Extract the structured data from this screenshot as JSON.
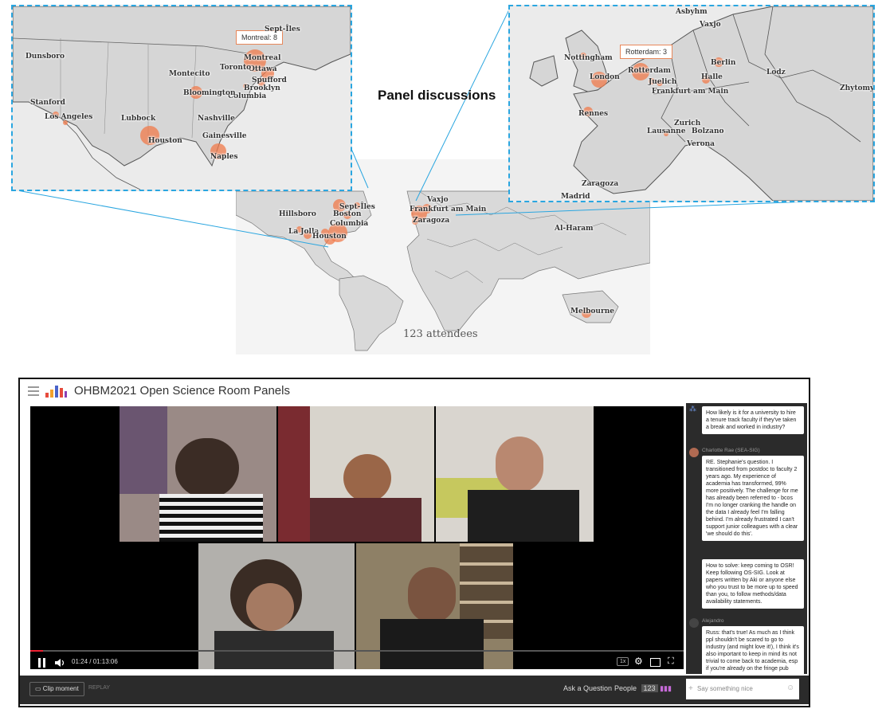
{
  "map": {
    "panel_title": "Panel discussions",
    "attendees_label": "123 attendees",
    "us_tooltip": "Montreal: 8",
    "eu_tooltip": "Rotterdam: 3",
    "us_cities": [
      "Dunsboro",
      "Montreal",
      "Ottawa",
      "Spufford",
      "Brooklyn",
      "Columbia",
      "Bloomington",
      "Stanford",
      "Los Angeles",
      "Lubbock",
      "Nashville",
      "Houston",
      "Gainesville",
      "Naples",
      "Montecito",
      "Toronto",
      "Sept-Îles"
    ],
    "eu_cities": [
      "Nottingham",
      "London",
      "Rotterdam",
      "Juelich",
      "Frankfurt am Main",
      "Berlin",
      "Halle",
      "Lodz",
      "Rennes",
      "Zurich",
      "Lausanne",
      "Bolzano",
      "Verona",
      "Zaragoza",
      "Madrid",
      "Zhytomyr",
      "Asbyhm",
      "Vaxjo"
    ],
    "world_cities": [
      "Sept-Îles",
      "Hillsboro",
      "Columbia",
      "La Jolla",
      "Houston",
      "Boston",
      "Frankfurt am Main",
      "Vaxjo",
      "Zaragoza",
      "Al-Haram",
      "Melbourne"
    ]
  },
  "player": {
    "title": "OHBM2021 Open Science Room Panels",
    "time": "01:24 / 01:13:06",
    "speed": "1x",
    "clip_moment": "Clip moment",
    "replay": "REPLAY",
    "ask_question": "Ask a Question",
    "people_label": "People",
    "people_count": "123",
    "chat_placeholder": "Say something nice"
  },
  "chat": {
    "messages": [
      {
        "author": "",
        "text": "How likely is it for a university to hire a tenure track faculty if they've taken a break and worked in industry?"
      },
      {
        "author": "Charlotte Rae (SEA-SIG)",
        "text": "RE. Stephanie's question. I transitioned from postdoc to faculty 2 years ago. My experience of academia has transformed, 99% more positively. The challenge for me has already been referred to - bcos I'm no longer cranking the handle on the data I already feel I'm falling behind. I'm already frustrated I can't support junior colleagues with a clear 'we should do this'."
      },
      {
        "author": "",
        "text": "How to solve: keep coming to OSR! Keep following OS-SIG. Look at papers written by Aki or anyone else who you trust to be more up to speed than you, to follow methods/data availability statements."
      },
      {
        "author": "Alejandro",
        "text": "Russ: that's true! As much as I think ppl shouldn't be scared to go to industry (and might love it!), I think it's also important to keep in mind its not trivial to come back to academia, esp if you're already on the fringe pub wise"
      }
    ]
  },
  "colors": {
    "accent_marker": "#f07a4a",
    "inset_border": "#2aa6e0",
    "chat_bg": "#2b2b2b"
  }
}
